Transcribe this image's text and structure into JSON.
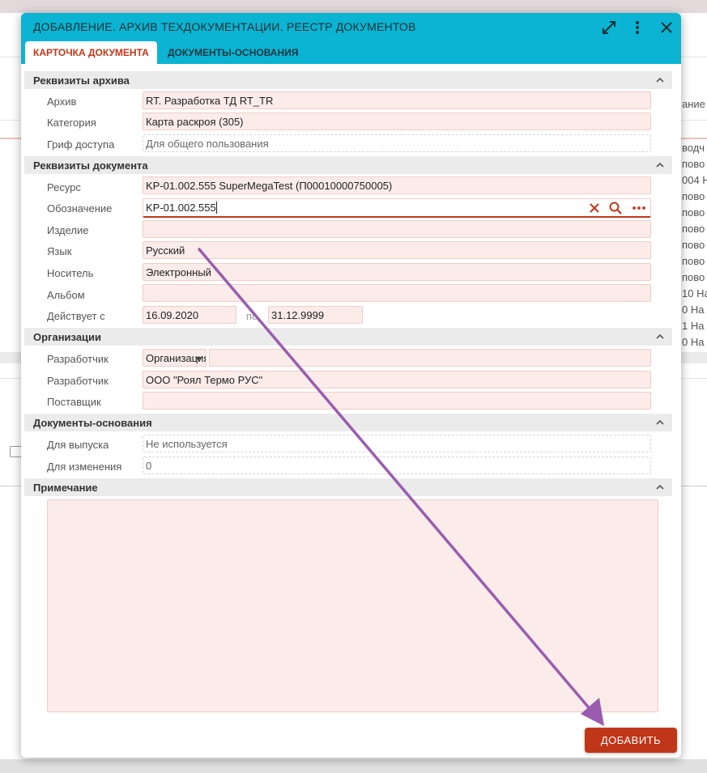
{
  "dialog": {
    "title": "ДОБАВЛЕНИЕ. АРХИВ ТЕХДОКУМЕНТАЦИИ. РЕЕСТР ДОКУМЕНТОВ",
    "tabs": [
      {
        "label": "КАРТОЧКА ДОКУМЕНТА",
        "active": true
      },
      {
        "label": "ДОКУМЕНТЫ-ОСНОВАНИЯ",
        "active": false
      }
    ],
    "header_icons": [
      "expand-icon",
      "more-vertical-icon",
      "close-icon"
    ]
  },
  "sections": {
    "archive": {
      "title": "Реквизиты архива",
      "fields": {
        "archive": {
          "label": "Архив",
          "value": "RT. Разработка ТД RT_TR"
        },
        "category": {
          "label": "Категория",
          "value": "Карта раскроя (305)"
        },
        "access": {
          "label": "Гриф доступа",
          "value": "Для общего пользования"
        }
      }
    },
    "document": {
      "title": "Реквизиты документа",
      "fields": {
        "resource": {
          "label": "Ресурс",
          "value": "KP-01.002.555 SuperMegaTest (П00010000750005)"
        },
        "designation": {
          "label": "Обозначение",
          "value": "KP-01.002.555"
        },
        "product": {
          "label": "Изделие",
          "value": ""
        },
        "language": {
          "label": "Язык",
          "value": "Русский"
        },
        "medium": {
          "label": "Носитель",
          "value": "Электронный"
        },
        "album": {
          "label": "Альбом",
          "value": ""
        },
        "valid": {
          "label": "Действует с",
          "from": "16.09.2020",
          "to_label": "по",
          "to": "31.12.9999"
        }
      }
    },
    "organizations": {
      "title": "Организации",
      "fields": {
        "developer1": {
          "label": "Разработчик",
          "type": "Организация",
          "value": ""
        },
        "developer2": {
          "label": "Разработчик",
          "value": "ООО \"Роял Термо РУС\""
        },
        "supplier": {
          "label": "Поставщик",
          "value": ""
        }
      }
    },
    "basis": {
      "title": "Документы-основания",
      "fields": {
        "release": {
          "label": "Для выпуска",
          "value": "Не используется"
        },
        "change": {
          "label": "Для изменения",
          "value": "0"
        }
      }
    },
    "notes": {
      "title": "Примечание",
      "value": ""
    }
  },
  "actions": {
    "add_label": "ДОБАВИТЬ"
  },
  "background": {
    "right_column": [
      "ание",
      "водч",
      "пово",
      "004 Н",
      "пово",
      "пово",
      "пово",
      "пово",
      "пово",
      "пово",
      "10 На",
      "0 На",
      "1 На",
      "0 На"
    ]
  },
  "colors": {
    "header": "#0ab4d2",
    "accent": "#c03618",
    "field_bg": "#fbecea",
    "annotation_arrow": "#9b5cb0"
  }
}
